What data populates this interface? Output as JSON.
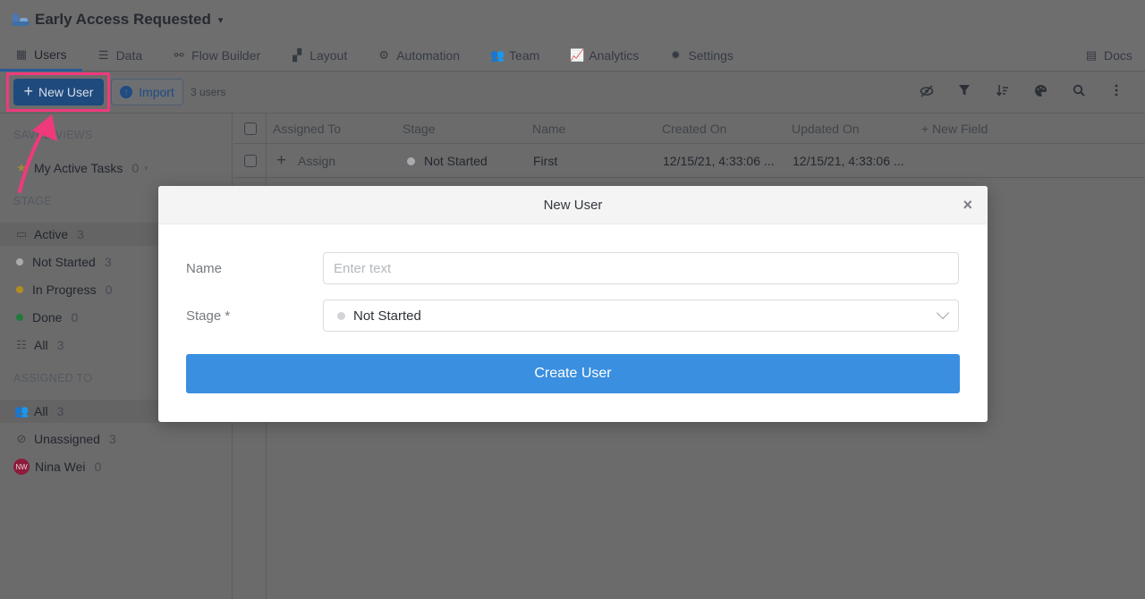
{
  "app": {
    "title": "Early Access Requested"
  },
  "tabs": [
    {
      "label": "Users",
      "icon": "table-icon"
    },
    {
      "label": "Data",
      "icon": "database-icon"
    },
    {
      "label": "Flow Builder",
      "icon": "flow-icon"
    },
    {
      "label": "Layout",
      "icon": "layout-icon"
    },
    {
      "label": "Automation",
      "icon": "robot-icon"
    },
    {
      "label": "Team",
      "icon": "team-icon"
    },
    {
      "label": "Analytics",
      "icon": "chart-icon"
    },
    {
      "label": "Settings",
      "icon": "gear-icon"
    },
    {
      "label": "Docs",
      "icon": "book-icon"
    }
  ],
  "toolbar": {
    "new_label": "New User",
    "import_label": "Import",
    "count": "3 users"
  },
  "sidebar": {
    "saved_views_heading": "SAVED VIEWS",
    "saved_views": [
      {
        "label": "My Active Tasks",
        "count": "0"
      }
    ],
    "stage_heading": "STAGE",
    "stages": [
      {
        "label": "Active",
        "count": "3"
      },
      {
        "label": "Not Started",
        "count": "3",
        "color": "#a9abae"
      },
      {
        "label": "In Progress",
        "count": "0",
        "color": "#b08f1e"
      },
      {
        "label": "Done",
        "count": "0",
        "color": "#1f7a3c"
      },
      {
        "label": "All",
        "count": "3"
      }
    ],
    "assigned_heading": "ASSIGNED TO",
    "assigned": [
      {
        "label": "All",
        "count": "3"
      },
      {
        "label": "Unassigned",
        "count": "3"
      },
      {
        "label": "Nina Wei",
        "count": "0",
        "initials": "NW"
      }
    ]
  },
  "grid": {
    "columns": [
      "Assigned To",
      "Stage",
      "Name",
      "Created On",
      "Updated On",
      "+ New Field"
    ],
    "rows": [
      {
        "assigned": "Assign",
        "stage": "Not Started",
        "name": "First",
        "created": "12/15/21, 4:33:06 ...",
        "updated": "12/15/21, 4:33:06 ..."
      }
    ]
  },
  "modal": {
    "title": "New User",
    "name_label": "Name",
    "name_placeholder": "Enter text",
    "stage_label": "Stage *",
    "stage_value": "Not Started",
    "submit_label": "Create User"
  },
  "colors": {
    "accent": "#3a8fe0",
    "highlight": "#f0397b"
  }
}
